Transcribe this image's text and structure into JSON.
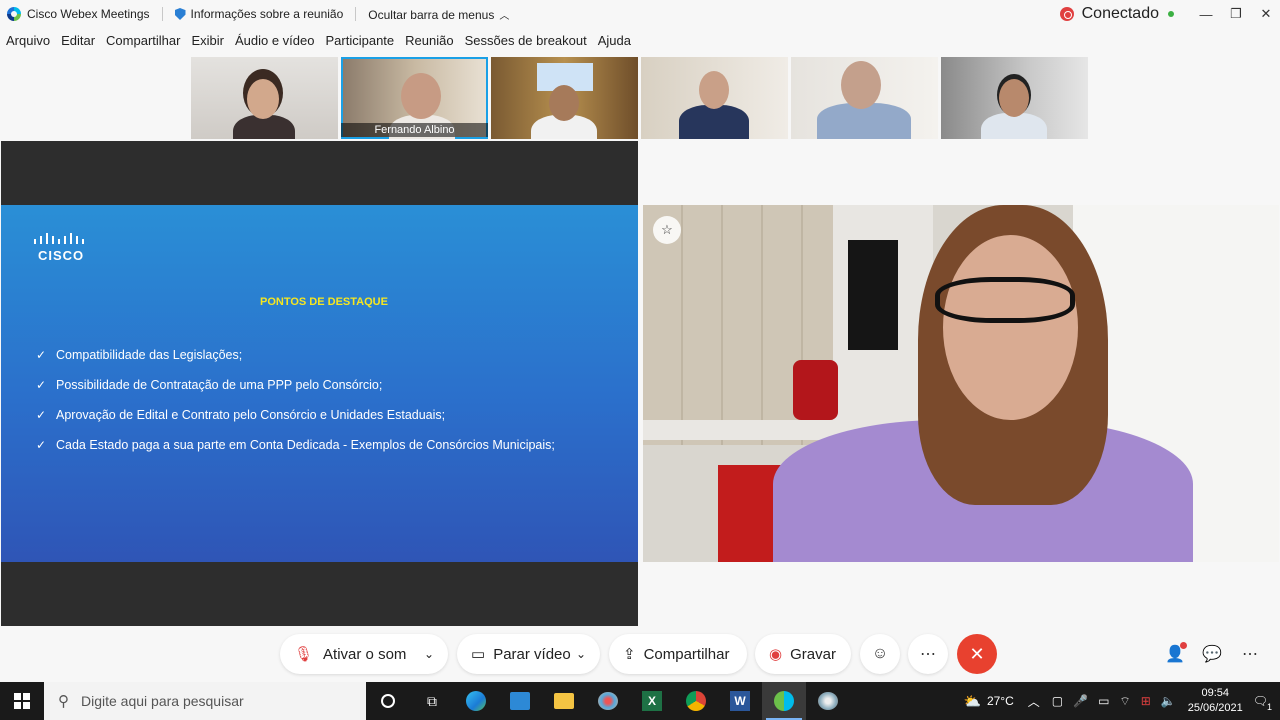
{
  "titlebar": {
    "app_name": "Cisco Webex Meetings",
    "meeting_info": "Informações sobre a reunião",
    "hide_menu": "Ocultar barra de menus",
    "status": "Conectado"
  },
  "menu": [
    "Arquivo",
    "Editar",
    "Compartilhar",
    "Exibir",
    "Áudio e vídeo",
    "Participante",
    "Reunião",
    "Sessões de breakout",
    "Ajuda"
  ],
  "participants": [
    {
      "name": ""
    },
    {
      "name": "Fernando Albino"
    },
    {
      "name": ""
    },
    {
      "name": ""
    },
    {
      "name": ""
    },
    {
      "name": ""
    }
  ],
  "slide": {
    "logo_text": "CISCO",
    "title": "PONTOS DE DESTAQUE",
    "bullets": [
      "Compatibilidade das Legislações;",
      "Possibilidade de Contratação de uma PPP pelo Consórcio;",
      "Aprovação de Edital e Contrato pelo Consórcio e Unidades Estaduais;",
      "Cada Estado paga a sua parte em Conta Dedicada - Exemplos de Consórcios Municipais;"
    ]
  },
  "controls": {
    "mute": "Ativar o som",
    "video": "Parar vídeo",
    "share": "Compartilhar",
    "record": "Gravar"
  },
  "taskbar": {
    "search_placeholder": "Digite aqui para pesquisar",
    "temperature": "27°C",
    "time": "09:54",
    "date": "25/06/2021",
    "notification_count": "1"
  },
  "colors": {
    "accent": "#1aa0e6",
    "end_call": "#e8412f",
    "slide_title": "#f6e620"
  }
}
